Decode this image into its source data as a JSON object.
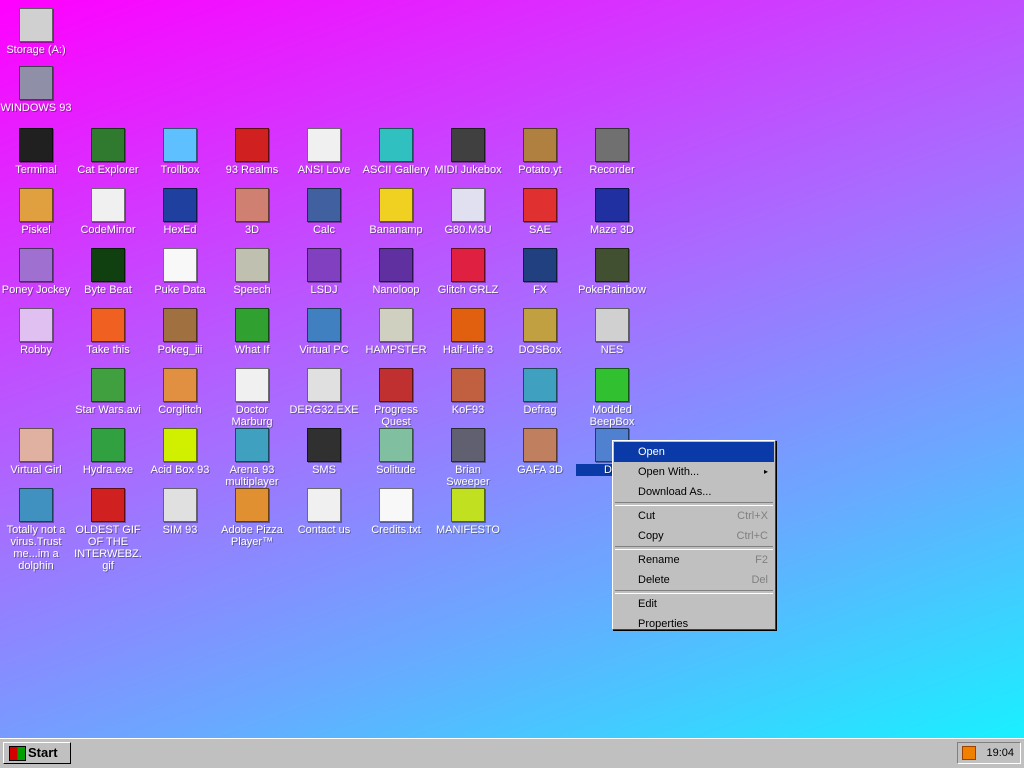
{
  "desktop": {
    "icons": [
      {
        "label": "Storage (A:)",
        "color": "#d0d0d0"
      },
      {
        "label": "WINDOWS 93",
        "color": "#8f8fa8"
      },
      {
        "label": "Terminal",
        "color": "#202020"
      },
      {
        "label": "Cat Explorer",
        "color": "#2f7a2f"
      },
      {
        "label": "Trollbox",
        "color": "#5fc0ff"
      },
      {
        "label": "93 Realms",
        "color": "#d02020"
      },
      {
        "label": "ANSI Love",
        "color": "#f0f0f0"
      },
      {
        "label": "ASCII Gallery",
        "color": "#30c0c0"
      },
      {
        "label": "MIDI Jukebox",
        "color": "#404040"
      },
      {
        "label": "Potato.yt",
        "color": "#b08040"
      },
      {
        "label": "Recorder",
        "color": "#707070"
      },
      {
        "label": "Piskel",
        "color": "#e0a040"
      },
      {
        "label": "CodeMirror",
        "color": "#f0f0f0"
      },
      {
        "label": "HexEd",
        "color": "#2040a0"
      },
      {
        "label": "3D",
        "color": "#d08070"
      },
      {
        "label": "Calc",
        "color": "#4060a0"
      },
      {
        "label": "Bananamp",
        "color": "#f0d020"
      },
      {
        "label": "G80.M3U",
        "color": "#e0e0f0"
      },
      {
        "label": "SAE",
        "color": "#e03030"
      },
      {
        "label": "Maze 3D",
        "color": "#2030a0"
      },
      {
        "label": "Poney Jockey",
        "color": "#a070d0"
      },
      {
        "label": "Byte Beat",
        "color": "#104010"
      },
      {
        "label": "Puke Data",
        "color": "#f8f8f8"
      },
      {
        "label": "Speech",
        "color": "#c0c0b0"
      },
      {
        "label": "LSDJ",
        "color": "#8040c0"
      },
      {
        "label": "Nanoloop",
        "color": "#6030a0"
      },
      {
        "label": "Glitch GRLZ",
        "color": "#e02040"
      },
      {
        "label": "FX",
        "color": "#204080"
      },
      {
        "label": "PokeRainbow",
        "color": "#405030"
      },
      {
        "label": "Robby",
        "color": "#e0c0f0"
      },
      {
        "label": "Take this",
        "color": "#f06020"
      },
      {
        "label": "Pokeg_iii",
        "color": "#a07040"
      },
      {
        "label": "What If",
        "color": "#30a030"
      },
      {
        "label": "Virtual PC",
        "color": "#4080c0"
      },
      {
        "label": "HAMPSTER",
        "color": "#d0d0c0"
      },
      {
        "label": "Half-Life 3",
        "color": "#e06010"
      },
      {
        "label": "DOSBox",
        "color": "#c0a040"
      },
      {
        "label": "NES",
        "color": "#d0d0d0"
      },
      {
        "label": "Star Wars.avi",
        "color": "#40a040"
      },
      {
        "label": "Corglitch",
        "color": "#e09040"
      },
      {
        "label": "Doctor Marburg",
        "color": "#f0f0f0"
      },
      {
        "label": "DERG32.EXE",
        "color": "#e0e0e0"
      },
      {
        "label": "Progress Quest",
        "color": "#c03030"
      },
      {
        "label": "KoF93",
        "color": "#c06040"
      },
      {
        "label": "Defrag",
        "color": "#40a0c0"
      },
      {
        "label": "Modded BeepBox",
        "color": "#30c030"
      },
      {
        "label": "Virtual Girl",
        "color": "#e0b0a0"
      },
      {
        "label": "Hydra.exe",
        "color": "#30a040"
      },
      {
        "label": "Acid Box 93",
        "color": "#d0f000"
      },
      {
        "label": "Arena 93 multiplayer",
        "color": "#40a0c0"
      },
      {
        "label": "SMS",
        "color": "#303030"
      },
      {
        "label": "Solitude",
        "color": "#80c0a0"
      },
      {
        "label": "Brian Sweeper",
        "color": "#606070"
      },
      {
        "label": "GAFA 3D",
        "color": "#c08060"
      },
      {
        "label": "DN",
        "color": "#5080d0"
      },
      {
        "label": "Totally not a virus.Trust me...im a dolphin",
        "color": "#4090c0"
      },
      {
        "label": "OLDEST GIF OF THE INTERWEBZ.gif",
        "color": "#d02020"
      },
      {
        "label": "SIM 93",
        "color": "#e0e0e0"
      },
      {
        "label": "Adobe Pizza Player™",
        "color": "#e09030"
      },
      {
        "label": "Contact us",
        "color": "#f0f0f0"
      },
      {
        "label": "Credits.txt",
        "color": "#f8f8f8"
      },
      {
        "label": "MANIFESTO",
        "color": "#c0e020"
      }
    ]
  },
  "context_menu": {
    "items": [
      {
        "label": "Open",
        "shortcut": ""
      },
      {
        "label": "Open With...",
        "shortcut": ""
      },
      {
        "label": "Download As...",
        "shortcut": ""
      },
      {
        "label": "Cut",
        "shortcut": "Ctrl+X"
      },
      {
        "label": "Copy",
        "shortcut": "Ctrl+C"
      },
      {
        "label": "Rename",
        "shortcut": "F2"
      },
      {
        "label": "Delete",
        "shortcut": "Del"
      },
      {
        "label": "Edit",
        "shortcut": ""
      },
      {
        "label": "Properties",
        "shortcut": ""
      }
    ],
    "submenu_arrow": "▸"
  },
  "taskbar": {
    "start_label": "Start",
    "clock": "19:04"
  }
}
